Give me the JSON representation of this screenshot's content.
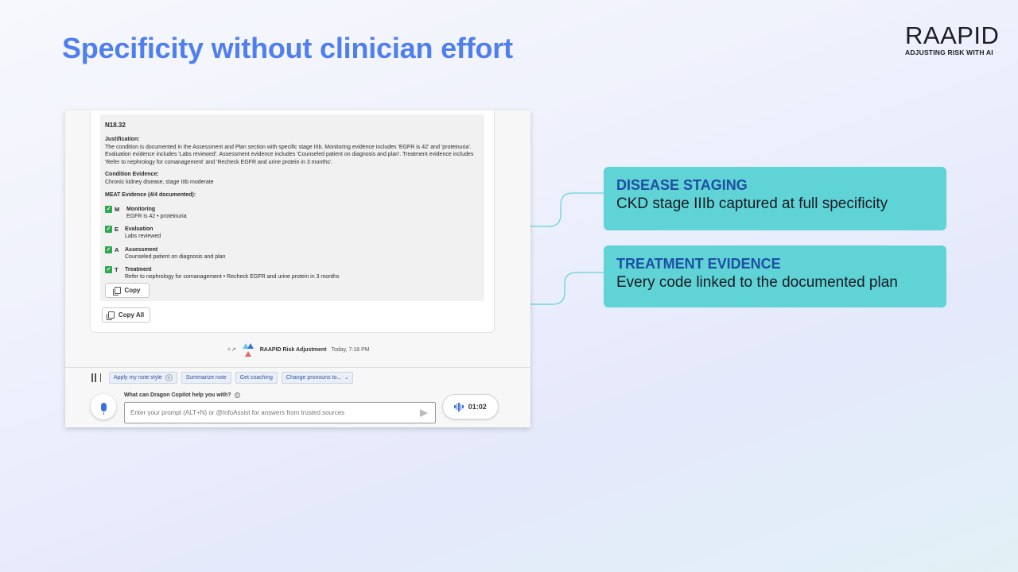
{
  "slide": {
    "title": "Specificity without clinician effort"
  },
  "logo": {
    "wordmark": "RAAPID",
    "tagline": "ADJUSTING RISK WITH AI"
  },
  "app": {
    "code": "N18.32",
    "justification_label": "Justification:",
    "justification_text": "The condition is documented in the Assessment and Plan section with specific stage IIIb. Monitoring evidence includes 'EGFR is 42' and 'proteinuria'. Evaluation evidence includes 'Labs reviewed'. Assessment evidence includes 'Counseled patient on diagnosis and plan'. Treatment evidence includes 'Refer to nephrology for comanagement' and 'Recheck EGFR and urine protein in 3 months'.",
    "condition_label": "Condition Evidence:",
    "condition_text": "Chronic kidney disease, stage IIIb moderate",
    "meat_header": "MEAT Evidence (4/4 documented):",
    "meat": [
      {
        "letter": "M",
        "name": "Monitoring",
        "detail": "EGFR is 42 • proteinuria"
      },
      {
        "letter": "E",
        "name": "Evaluation",
        "detail": "Labs reviewed"
      },
      {
        "letter": "A",
        "name": "Assessment",
        "detail": "Counseled patient on diagnosis and plan"
      },
      {
        "letter": "T",
        "name": "Treatment",
        "detail": "Refer to nephrology for comanagement • Recheck EGFR and urine protein in 3 months"
      }
    ],
    "copy_label": "Copy",
    "copy_all_label": "Copy All",
    "sender_name": "RAAPID Risk Adjustment",
    "sender_time": "Today, 7:18 PM",
    "chips": [
      "Apply my note style",
      "Summarize note",
      "Get coaching",
      "Change pronouns to..."
    ],
    "prompt_label": "What can Dragon Copilot help you with?",
    "prompt_placeholder": "Enter your prompt (ALT+N) or @InfoAssist for answers from trusted sources",
    "timer": "01:02",
    "accent_color": "#3b6ee0",
    "check_color": "#2fa84f"
  },
  "callouts": [
    {
      "title": "DISEASE STAGING",
      "text": "CKD stage IIIb captured at full specificity"
    },
    {
      "title": "TREATMENT EVIDENCE",
      "text": "Every code linked to the documented plan"
    }
  ],
  "colors": {
    "title": "#4f7fef",
    "callout_bg": "#5fd3d6",
    "callout_title": "#1f4fa3",
    "connector": "#5fd3d6"
  }
}
